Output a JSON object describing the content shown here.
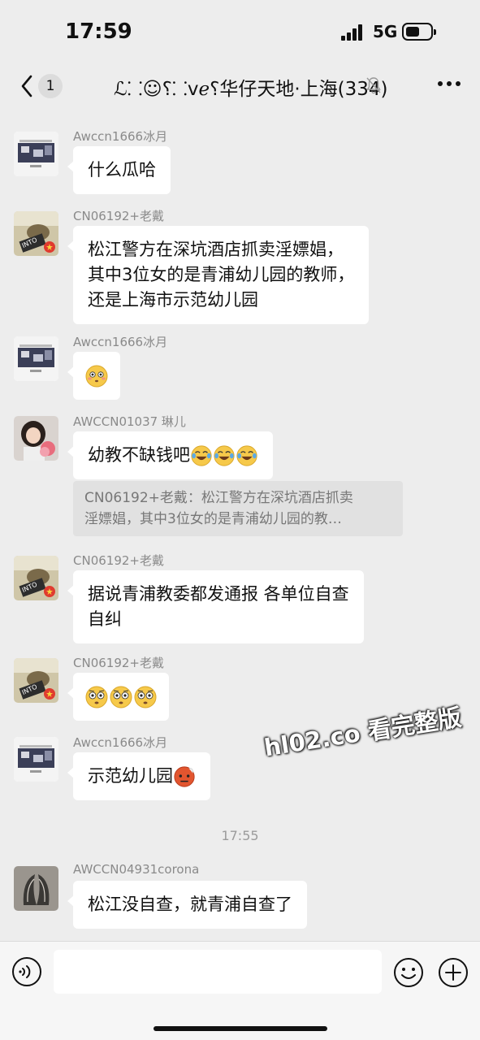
{
  "status_bar": {
    "time": "17:59",
    "network": "5G"
  },
  "header": {
    "back_count": "1",
    "title": "ℒ⸬☺⸮⸬vℯ⸮华仔天地·上海(334)"
  },
  "messages": [
    {
      "sender": "Awccn1666冰月",
      "lines": [
        "什么瓜哈"
      ]
    },
    {
      "sender": "CN06192+老戴",
      "lines": [
        "松江警方在深坑酒店抓卖淫嫖娼，",
        "其中3位女的是青浦幼儿园的教师，",
        "还是上海市示范幼儿园"
      ]
    },
    {
      "sender": "Awccn1666冰月",
      "emoji": "flushed-face"
    },
    {
      "sender": "AWCCN01037 琳儿",
      "lines": [
        "幼教不缺钱吧"
      ],
      "emoji": "laughing-face x3"
    },
    {
      "sender": "CN06192+老戴",
      "lines": [
        "据说青浦教委都发通报 各单位自查",
        "自纠"
      ]
    },
    {
      "sender": "CN06192+老戴",
      "emoji": "wide-eyed-face x3"
    },
    {
      "sender": "Awccn1666冰月",
      "lines": [
        "示范幼儿园"
      ],
      "emoji": "red-face"
    },
    {
      "sender": "AWCCN04931corona",
      "lines": [
        "松江没自查，就青浦自查了"
      ]
    }
  ],
  "quote": {
    "lines": [
      "CN06192+老戴：松江警方在深坑酒店抓卖",
      "淫嫖娼，其中3位女的是青浦幼儿园的教…"
    ]
  },
  "timestamp": "17:55",
  "watermark": "hl02.co 看完整版",
  "input": {
    "value": "",
    "placeholder": ""
  },
  "colors": {
    "background": "#ededed",
    "bubble": "#ffffff",
    "input_bar": "#f6f6f6"
  }
}
